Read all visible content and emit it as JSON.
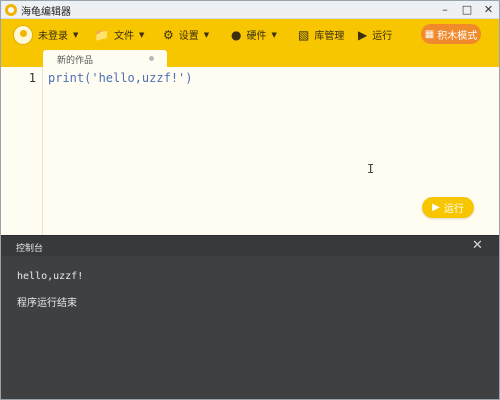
{
  "window": {
    "title": "海龟编辑器"
  },
  "toolbar": {
    "user_label": "未登录",
    "file_label": "文件",
    "settings_label": "设置",
    "hardware_label": "硬件",
    "library_label": "库管理",
    "run_label": "运行",
    "blocks_mode_label": "积木模式"
  },
  "tabs": [
    {
      "label": "新的作品"
    }
  ],
  "editor": {
    "line_numbers": [
      "1"
    ],
    "lines": [
      "print('hello,uzzf!')"
    ],
    "run_button_label": "运行"
  },
  "console": {
    "title": "控制台",
    "output": [
      "hello,uzzf!",
      "程序运行结束"
    ]
  }
}
